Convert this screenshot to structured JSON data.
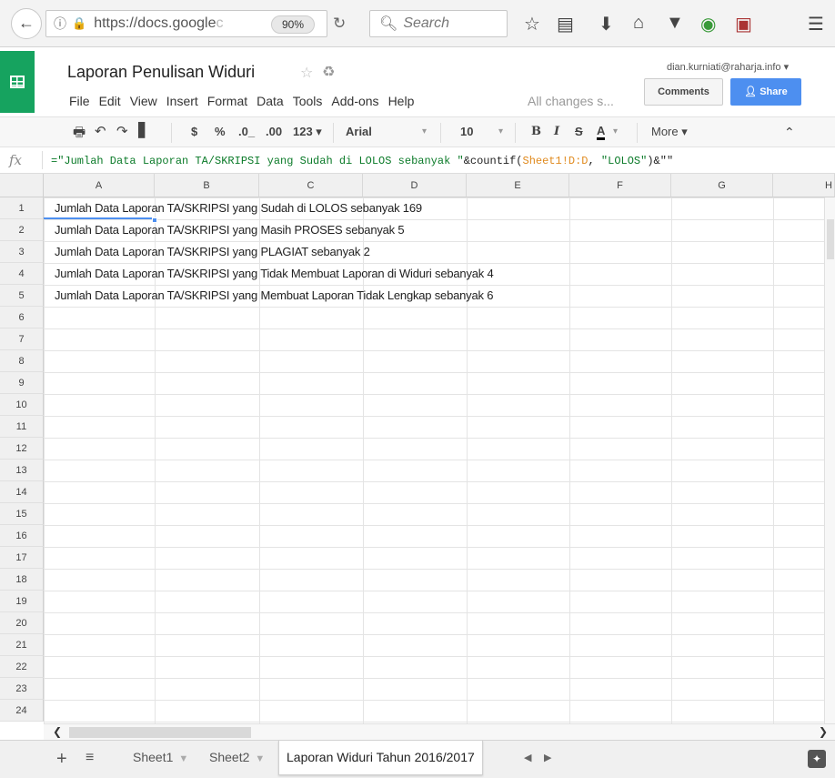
{
  "browser": {
    "url": "https://docs.google",
    "url_faded": "c",
    "zoom": "90%",
    "search_placeholder": "Search"
  },
  "doc": {
    "title": "Laporan Penulisan Widuri",
    "account": "dian.kurniati@raharja.info ▾",
    "autosave": "All changes s...",
    "comments_label": "Comments",
    "share_label": "Share",
    "menu": [
      "File",
      "Edit",
      "View",
      "Insert",
      "Format",
      "Data",
      "Tools",
      "Add-ons",
      "Help"
    ]
  },
  "toolbar": {
    "currency": "$",
    "percent": "%",
    "dec_decrease": ".0_",
    "dec_increase": ".00",
    "more_formats": "123 ▾",
    "font": "Arial",
    "font_size": "10",
    "bold": "B",
    "italic": "I",
    "strike": "S",
    "text_color": "A",
    "more": "More ▾"
  },
  "formula": {
    "part1": "=\"Jumlah Data Laporan TA/SKRIPSI yang Sudah di LOLOS sebanyak \"",
    "part2": "&countif(",
    "part3": "Sheet1!D:D",
    "part4": ", ",
    "part5": "\"LOLOS\"",
    "part6": ")&\"\""
  },
  "grid": {
    "columns": [
      "A",
      "B",
      "C",
      "D",
      "E",
      "F",
      "G",
      "H"
    ],
    "rows": [
      "1",
      "2",
      "3",
      "4",
      "5",
      "6",
      "7",
      "8",
      "9",
      "10",
      "11",
      "12",
      "13",
      "14",
      "15",
      "16",
      "17",
      "18",
      "19",
      "20",
      "21",
      "22",
      "23",
      "24"
    ],
    "cells": [
      "Jumlah Data Laporan TA/SKRIPSI yang Sudah di LOLOS sebanyak 169",
      "Jumlah Data Laporan TA/SKRIPSI yang Masih PROSES sebanyak 5",
      "Jumlah Data Laporan TA/SKRIPSI yang PLAGIAT sebanyak 2",
      "Jumlah Data Laporan TA/SKRIPSI yang Tidak Membuat Laporan di Widuri sebanyak 4",
      "Jumlah Data Laporan TA/SKRIPSI yang Membuat Laporan Tidak Lengkap sebanyak 6"
    ]
  },
  "sheets": {
    "tabs": [
      "Sheet1",
      "Sheet2",
      "Laporan Widuri Tahun 2016/2017"
    ],
    "active_index": 2
  },
  "colors": {
    "brand_green": "#16a35f",
    "share_blue": "#4d8ff0",
    "formula_string": "#0a7a28",
    "formula_ref": "#e08a1e"
  }
}
